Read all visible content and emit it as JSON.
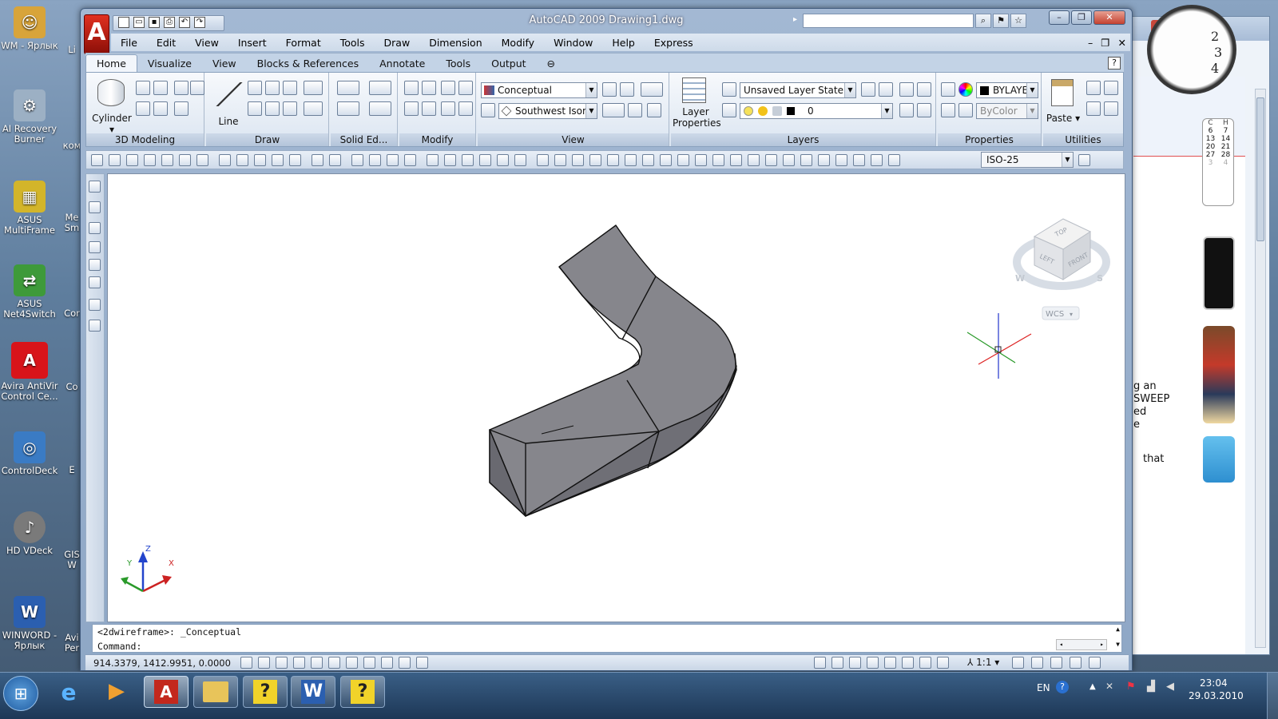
{
  "desktop_icons": [
    {
      "label": "WM - Ярлык",
      "icon": "person-folder-icon",
      "color": "#d8a43a"
    },
    {
      "label": "AI Recovery Burner",
      "icon": "ai-recovery-icon",
      "color": "#c9d4df"
    },
    {
      "label": "ASUS MultiFrame",
      "icon": "asus-multiframe-icon",
      "color": "#e4c329"
    },
    {
      "label": "ASUS Net4Switch",
      "icon": "asus-net4switch-icon",
      "color": "#3e9a3a"
    },
    {
      "label": "Avira AntiVir Control Ce...",
      "icon": "avira-icon",
      "color": "#d8141a"
    },
    {
      "label": "ControlDeck",
      "icon": "controldeck-icon",
      "color": "#3a7bc4"
    },
    {
      "label": "HD VDeck",
      "icon": "hd-vdeck-icon",
      "color": "#888888"
    },
    {
      "label": "WINWORD - Ярлык",
      "icon": "word-icon",
      "color": "#2b5fb0"
    }
  ],
  "desktop_icons_col2": [
    "Li",
    "ком",
    "Me Sm",
    "Cor",
    "Co",
    "E",
    "GIS W",
    "Avi Per"
  ],
  "app": {
    "title": "AutoCAD 2009  Drawing1.dwg",
    "logo_letter": "A"
  },
  "menu": [
    "File",
    "Edit",
    "View",
    "Insert",
    "Format",
    "Tools",
    "Draw",
    "Dimension",
    "Modify",
    "Window",
    "Help",
    "Express"
  ],
  "ribbon_tabs": [
    "Home",
    "Visualize",
    "View",
    "Blocks & References",
    "Annotate",
    "Tools",
    "Output"
  ],
  "panels": {
    "modeling": "3D Modeling",
    "draw": "Draw",
    "solid_edit": "Solid Ed...",
    "modify": "Modify",
    "view": "View",
    "layers": "Layers",
    "properties": "Properties",
    "utilities": "Utilities"
  },
  "labels": {
    "cylinder": "Cylinder",
    "line": "Line",
    "layer_properties": "Layer Properties",
    "paste": "Paste"
  },
  "combos": {
    "visual_style": "Conceptual",
    "view_preset": "Southwest Isome",
    "layer_state": "Unsaved Layer State",
    "layer": "0",
    "color": "BYLAYE",
    "linetype": "ByColor",
    "dim_style": "ISO-25"
  },
  "viewcube": {
    "top": "TOP",
    "left": "LEFT",
    "front": "FRONT",
    "west": "W",
    "south": "S",
    "wcs": "WCS"
  },
  "ucs": {
    "x": "X",
    "y": "Y",
    "z": "Z"
  },
  "command": {
    "history": "<2dwireframe>: _Conceptual",
    "prompt": "Command:"
  },
  "status": {
    "coords": "914.3379, 1412.9951, 0.0000",
    "scale": "1:1"
  },
  "bg_window_text": [
    "g an",
    "SWEEP",
    "ed",
    "e",
    "that"
  ],
  "calendar": {
    "header": [
      "С",
      "Н"
    ],
    "rows": [
      [
        "6",
        "7"
      ],
      [
        "13",
        "14"
      ],
      [
        "20",
        "21"
      ],
      [
        "27",
        "28"
      ],
      [
        "3",
        "4"
      ]
    ]
  },
  "clock_digits": [
    "2",
    "3",
    "4"
  ],
  "taskbar": {
    "lang": "EN",
    "time": "23:04",
    "date": "29.03.2010"
  },
  "colors": {
    "desktop": "#5f7e9e",
    "acad_frame": "#a3b8d3",
    "solid_face": "#7d7d82",
    "solid_top": "#8a8a8f"
  }
}
